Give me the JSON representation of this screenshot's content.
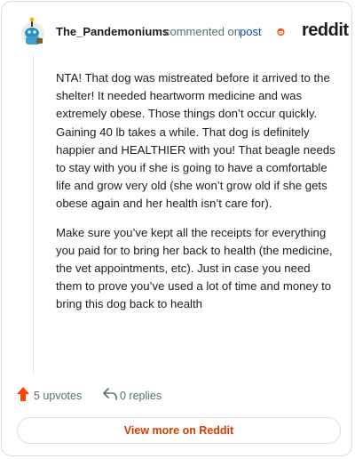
{
  "header": {
    "username": "The_Pandemoniums",
    "commented_text": "commented on",
    "post_link": "post",
    "brand": "reddit"
  },
  "comment": {
    "paragraphs": [
      "NTA! That dog was mistreated before it arrived to the shelter! It needed heartworm medicine and was extremely obese. Those things don’t occur quickly. Gaining 40 lb takes a while. That dog is definitely happier and HEALTHIER with you! That beagle needs to stay with you if she is going to have a comfortable life and grow very old (she won’t grow old if she gets obese again and her health isn’t care for).",
      "Make sure you’ve kept all the receipts for everything you paid for to bring her back to health (the medicine, the vet appointments, etc). Just in case you need them to prove you’ve used a lot of time and money to bring this dog back to health"
    ]
  },
  "actions": {
    "upvotes": "5 upvotes",
    "replies": "0 replies"
  },
  "footer": {
    "view_more": "View more on Reddit"
  },
  "colors": {
    "brand_orange": "#ff4500",
    "link_blue": "#0a4fb0",
    "muted": "#576f76",
    "button_text": "#d93a00"
  },
  "icons": {
    "avatar": "snoo-avatar",
    "logo": "reddit-logo-icon",
    "upvote": "upvote-arrow-icon",
    "reply": "reply-arrow-icon"
  }
}
